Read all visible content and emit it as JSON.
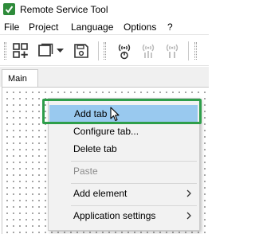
{
  "window": {
    "title": "Remote Service Tool"
  },
  "menubar": {
    "items": [
      "File",
      "Project",
      "Language",
      "Options",
      "?"
    ]
  },
  "tabs": [
    {
      "label": "Main"
    }
  ],
  "context_menu": {
    "items": [
      {
        "label": "Add tab",
        "enabled": true,
        "highlighted": true
      },
      {
        "label": "Configure tab...",
        "enabled": true
      },
      {
        "label": "Delete tab",
        "enabled": true
      },
      {
        "label": "Paste",
        "enabled": false
      },
      {
        "label": "Add element",
        "enabled": true,
        "submenu": true
      },
      {
        "label": "Application settings",
        "enabled": true,
        "submenu": true
      }
    ]
  },
  "colors": {
    "highlight": "#99c9ef",
    "focus_outline": "#2e9e4a",
    "disabled_text": "#8d8d8d"
  }
}
